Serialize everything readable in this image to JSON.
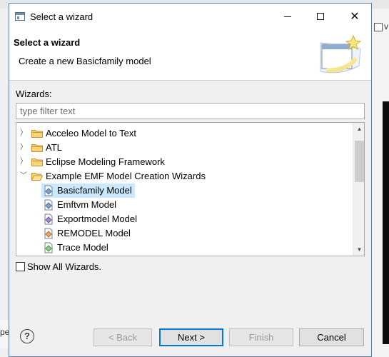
{
  "window": {
    "title": "Select a wizard",
    "controls": {
      "minimize_icon": "minimize-icon",
      "maximize_icon": "maximize-icon",
      "close_icon": "close-icon"
    }
  },
  "header": {
    "title": "Select a wizard",
    "description": "Create a new Basicfamily model",
    "banner_icon": "new-wizard-banner-icon"
  },
  "wizards_label": "Wizards:",
  "filter": {
    "placeholder": "type filter text",
    "value": ""
  },
  "tree": {
    "items": [
      {
        "label": "Acceleo Model to Text",
        "type": "folder",
        "expanded": false,
        "level": 0
      },
      {
        "label": "ATL",
        "type": "folder",
        "expanded": false,
        "level": 0
      },
      {
        "label": "Eclipse Modeling Framework",
        "type": "folder",
        "expanded": false,
        "level": 0
      },
      {
        "label": "Example EMF Model Creation Wizards",
        "type": "folder",
        "expanded": true,
        "level": 0
      },
      {
        "label": "Basicfamily Model",
        "type": "model",
        "level": 1,
        "selected": true
      },
      {
        "label": "Emftvm Model",
        "type": "model",
        "level": 1
      },
      {
        "label": "Exportmodel Model",
        "type": "model",
        "level": 1
      },
      {
        "label": "REMODEL Model",
        "type": "model",
        "level": 1
      },
      {
        "label": "Trace Model",
        "type": "model",
        "level": 1
      }
    ]
  },
  "show_all": {
    "label": "Show All Wizards.",
    "checked": false
  },
  "buttons": {
    "help_icon": "help-icon",
    "back": "< Back",
    "next": "Next >",
    "finish": "Finish",
    "cancel": "Cancel"
  },
  "colors": {
    "selection": "#cce8ff",
    "default_button_border": "#0078d7",
    "folder": "#e8b84a"
  }
}
